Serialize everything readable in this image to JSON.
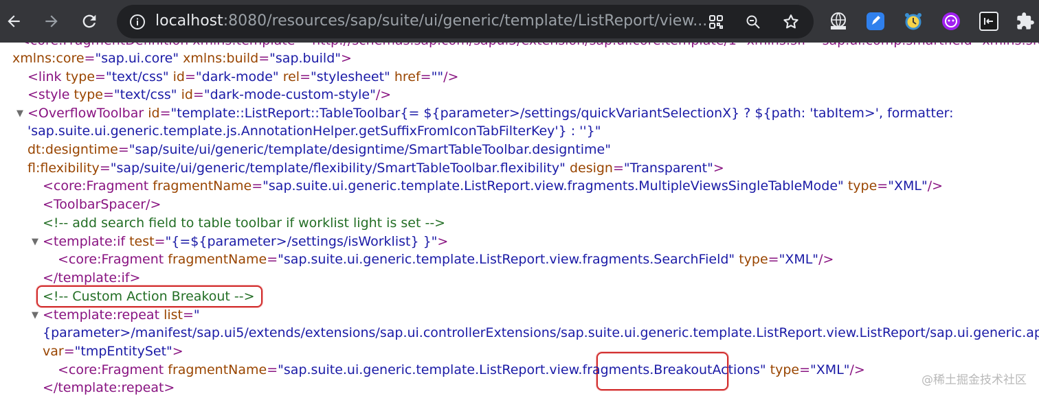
{
  "browser": {
    "url_host": "localhost",
    "url_rest": ":8080/resources/sap/suite/ui/generic/template/ListReport/view..."
  },
  "source": {
    "line0": {
      "text": "<core:FragmentDefinition xmlns:template=\"http://schemas.sap.com/sapui5/extension/sap.ui.core.template/1\" xmlns:sfi=\"sap.ui.comp.smartfield\" xmlns:sfo=\"sap.ui.comp.smartform\" xmlns=\"sap.m\""
    },
    "line1": {
      "ns1_name": "xmlns:core",
      "ns1_val": "\"sap.ui.core\"",
      "ns2_name": "xmlns:build",
      "ns2_val": "\"sap.build\"",
      "close": ">"
    },
    "line2": {
      "open": "<link",
      "a1": "type",
      "v1": "\"text/css\"",
      "a2": "id",
      "v2": "\"dark-mode\"",
      "a3": "rel",
      "v3": "\"stylesheet\"",
      "a4": "href",
      "v4": "\"\"",
      "close": "/>"
    },
    "line3": {
      "open": "<style",
      "a1": "type",
      "v1": "\"text/css\"",
      "a2": "id",
      "v2": "\"dark-mode-custom-style\"",
      "close": "/>"
    },
    "line4": {
      "open": "<OverflowToolbar",
      "a1": "id",
      "v1": "\"template::ListReport::TableToolbar{= ${parameter>/settings/quickVariantSelectionX} ? ${path: 'tabItem>', formatter:"
    },
    "line5": {
      "v1": "'sap.suite.ui.generic.template.js.AnnotationHelper.getSuffixFromIconTabFilterKey'} : ''}\""
    },
    "line6": {
      "a1": "dt:designtime",
      "v1": "\"sap/suite/ui/generic/template/designtime/SmartTableToolbar.designtime\""
    },
    "line7": {
      "a1": "fl:flexibility",
      "v1": "\"sap/suite/ui/generic/template/flexibility/SmartTableToolbar.flexibility\"",
      "a2": "design",
      "v2": "\"Transparent\"",
      "close": ">"
    },
    "line8": {
      "open": "<core:Fragment",
      "a1": "fragmentName",
      "v1": "\"sap.suite.ui.generic.template.ListReport.view.fragments.MultipleViewsSingleTableMode\"",
      "a2": "type",
      "v2": "\"XML\"",
      "close": "/>"
    },
    "line9": {
      "tag": "<ToolbarSpacer/>"
    },
    "line10": {
      "comment": "<!-- add search field to table toolbar if worklist light is set -->"
    },
    "line11": {
      "open": "<template:if",
      "a1": "test",
      "v1": "\"{=${parameter>/settings/isWorklist} }\"",
      "close": ">"
    },
    "line12": {
      "open": "<core:Fragment",
      "a1": "fragmentName",
      "v1": "\"sap.suite.ui.generic.template.ListReport.view.fragments.SearchField\"",
      "a2": "type",
      "v2": "\"XML\"",
      "close": "/>"
    },
    "line13": {
      "tag": "</template:if>"
    },
    "line14": {
      "comment": "<!--  Custom Action Breakout  -->"
    },
    "line15": {
      "open": "<template:repeat",
      "a1": "list",
      "v1": "\""
    },
    "line16": {
      "v1": "{parameter>/manifest/sap.ui5/extends/extensions/sap.ui.controllerExtensions/sap.suite.ui.generic.template.ListReport.view.ListReport/sap.ui.generic.app}\""
    },
    "line17": {
      "a1": "var",
      "v1": "\"tmpEntitySet\"",
      "close": ">"
    },
    "line18": {
      "open": "<core:Fragment",
      "a1": "fragmentName",
      "v1a": "\"sap.suite.ui.generic.template.ListReport.view.fragmen",
      "v1b": "ts.BreakoutActions\"",
      "a2": "type",
      "v2": "\"XML\"",
      "close": "/>"
    },
    "line19": {
      "tag": "</template:repeat>"
    }
  },
  "watermark": "@稀土掘金技术社区",
  "colors": {
    "tag": "#881280",
    "attr_name": "#994500",
    "attr_value": "#1a1aa6",
    "comment": "#236e25",
    "highlight": "#d22d2d"
  }
}
